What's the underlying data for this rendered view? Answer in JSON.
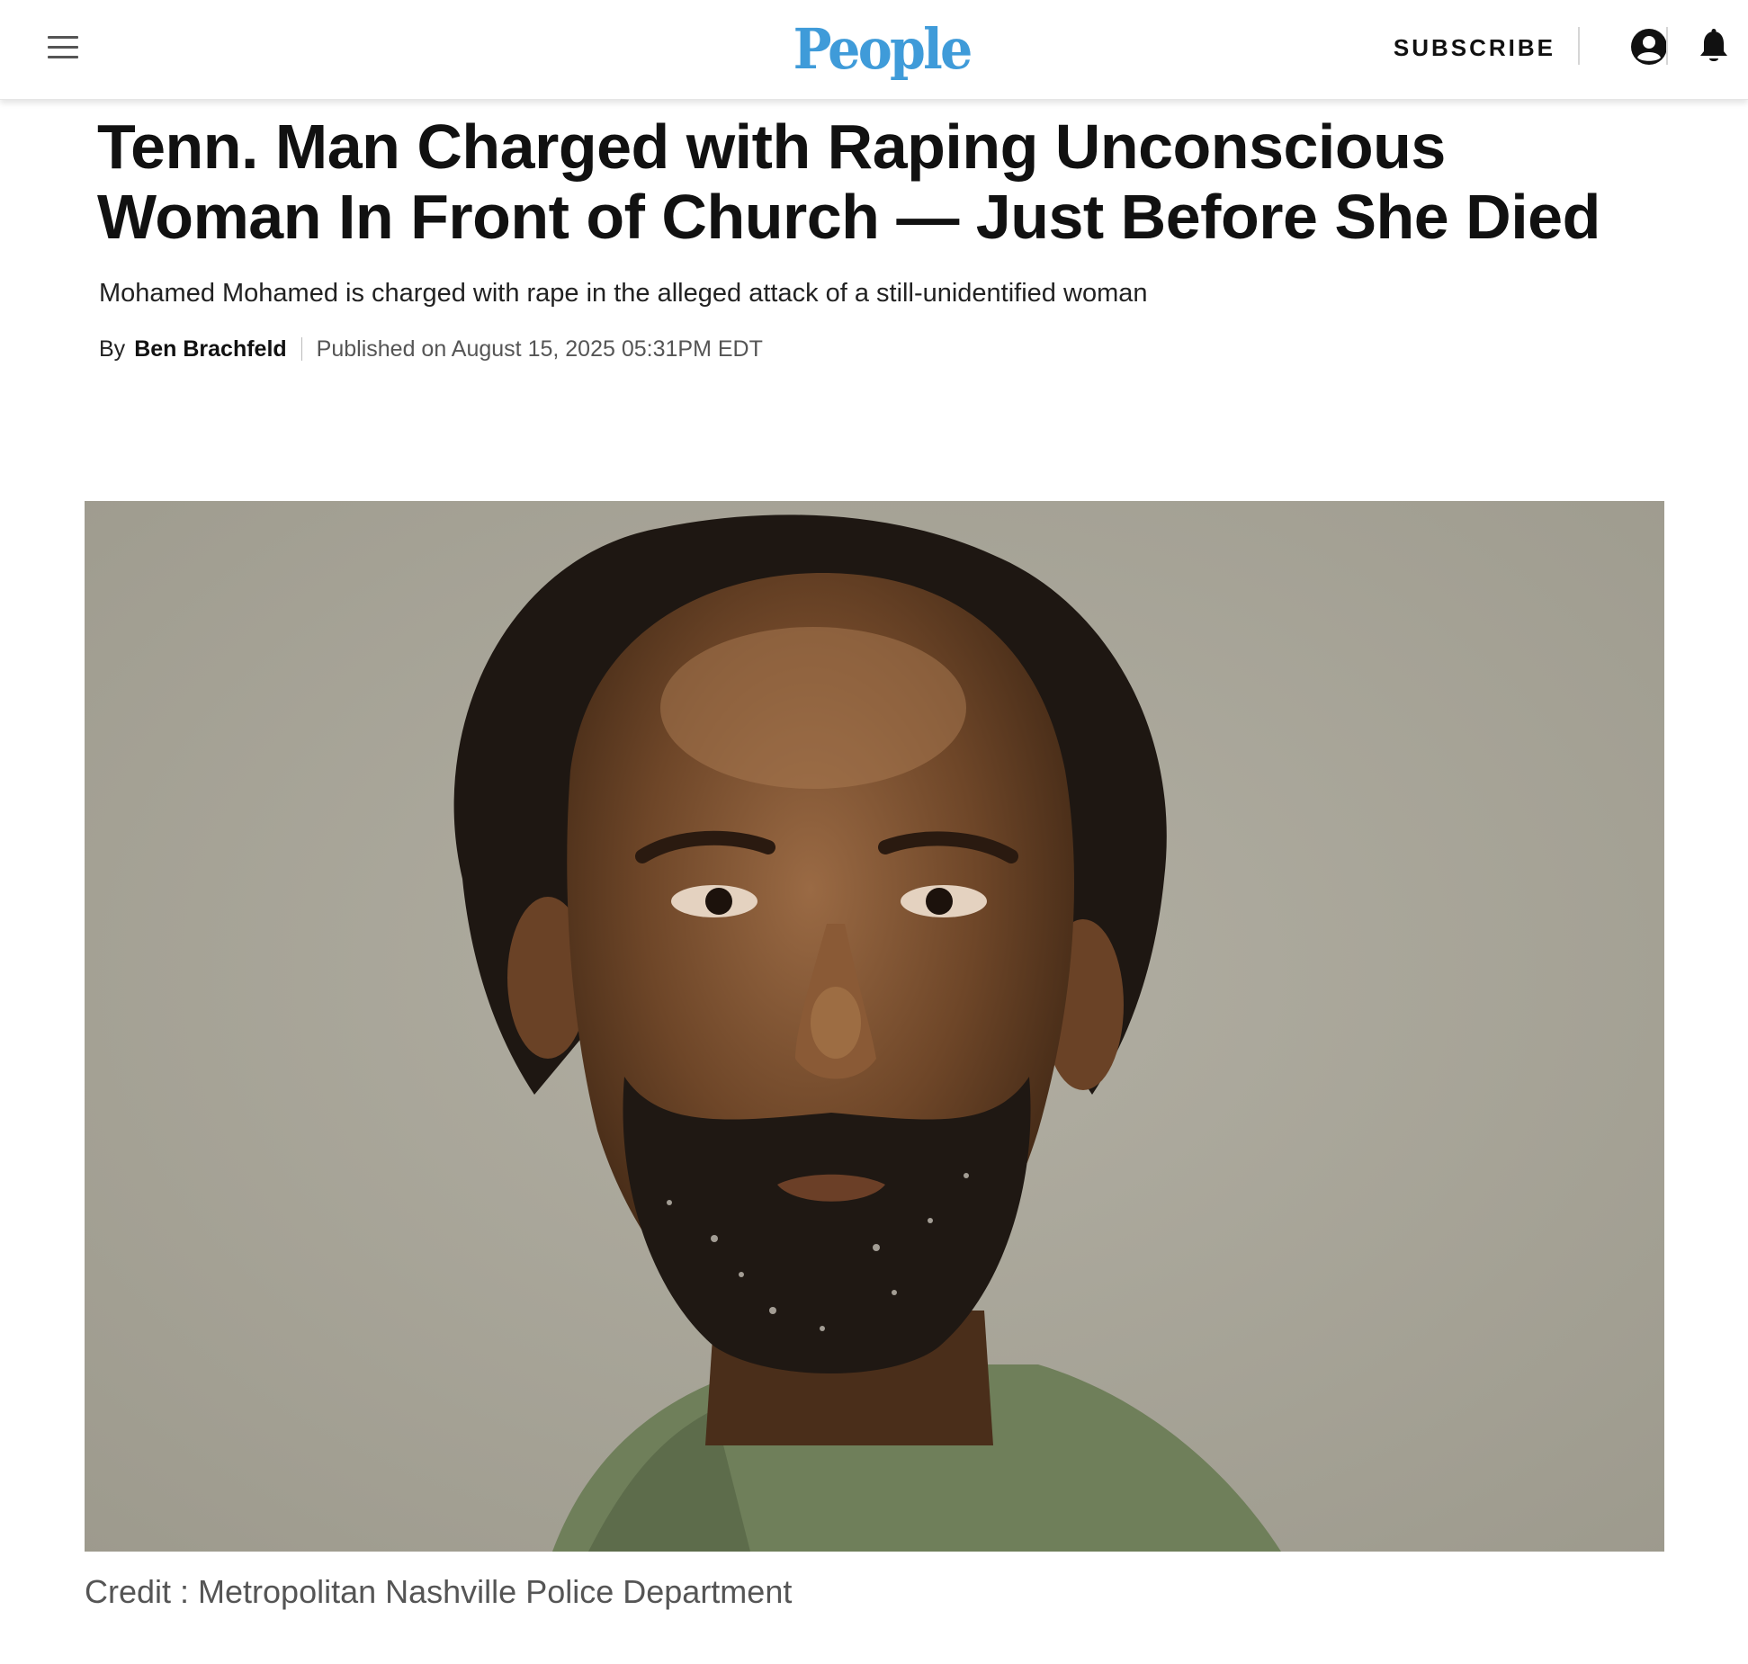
{
  "header": {
    "logo": "People",
    "subscribe_label": "SUBSCRIBE",
    "menu_icon": "hamburger-menu-icon",
    "account_icon": "account-icon",
    "bell_icon": "notification-bell-icon",
    "logo_color": "#3f9bd9"
  },
  "article": {
    "headline": "Tenn. Man Charged with Raping Unconscious Woman In Front of Church — Just Before She Died",
    "dek": "Mohamed Mohamed is charged with rape in the alleged attack of a still-unidentified woman",
    "byline_prefix": "By",
    "author": "Ben Brachfeld",
    "published": "Published on August 15, 2025 05:31PM EDT",
    "image_credit": "Credit : Metropolitan Nashville Police Department"
  }
}
